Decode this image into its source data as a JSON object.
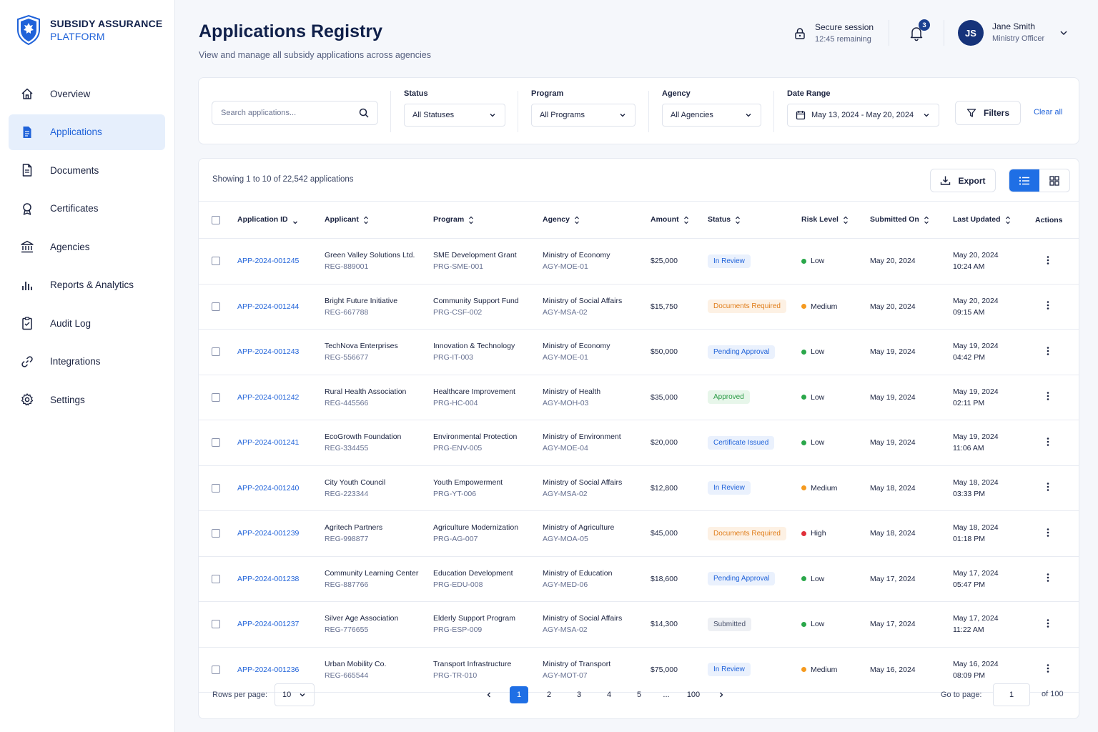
{
  "brand": {
    "line1": "SUBSIDY ASSURANCE",
    "line2": "PLATFORM"
  },
  "nav": [
    {
      "label": "Overview",
      "icon": "home-icon"
    },
    {
      "label": "Applications",
      "icon": "file-icon",
      "active": true
    },
    {
      "label": "Documents",
      "icon": "document-icon"
    },
    {
      "label": "Certificates",
      "icon": "certificate-icon"
    },
    {
      "label": "Agencies",
      "icon": "bank-icon"
    },
    {
      "label": "Reports & Analytics",
      "icon": "bar-chart-icon"
    },
    {
      "label": "Audit Log",
      "icon": "clipboard-icon"
    },
    {
      "label": "Integrations",
      "icon": "link-icon"
    },
    {
      "label": "Settings",
      "icon": "gear-icon"
    }
  ],
  "header": {
    "title": "Applications Registry",
    "subtitle": "View and manage all subsidy applications across agencies",
    "session_title": "Secure session",
    "session_time": "12:45 remaining",
    "notifications": "3",
    "user_initials": "JS",
    "user_name": "Jane Smith",
    "user_role": "Ministry Officer"
  },
  "filters": {
    "search_placeholder": "Search applications...",
    "status_label": "Status",
    "status_value": "All Statuses",
    "program_label": "Program",
    "program_value": "All Programs",
    "agency_label": "Agency",
    "agency_value": "All Agencies",
    "date_label": "Date Range",
    "date_value": "May 13, 2024 - May 20, 2024",
    "filters_button": "Filters",
    "clear_all": "Clear all"
  },
  "table": {
    "showing": "Showing 1 to 10 of 22,542 applications",
    "export": "Export",
    "columns": [
      "Application ID",
      "Applicant",
      "Program",
      "Agency",
      "Amount",
      "Status",
      "Risk Level",
      "Submitted On",
      "Last Updated",
      "Actions"
    ],
    "rows": [
      {
        "id": "APP-2024-001245",
        "applicant": "Green Valley Solutions Ltd.",
        "reg": "REG-889001",
        "program": "SME Development Grant",
        "prg": "PRG-SME-001",
        "agency": "Ministry of Economy",
        "agy": "AGY-MOE-01",
        "amount": "$25,000",
        "status": "In Review",
        "status_class": "b-review",
        "risk": "Low",
        "risk_class": "dot-low",
        "submitted": "May 20, 2024",
        "updated_date": "May 20, 2024",
        "updated_time": "10:24 AM"
      },
      {
        "id": "APP-2024-001244",
        "applicant": "Bright Future Initiative",
        "reg": "REG-667788",
        "program": "Community Support Fund",
        "prg": "PRG-CSF-002",
        "agency": "Ministry of Social Affairs",
        "agy": "AGY-MSA-02",
        "amount": "$15,750",
        "status": "Documents Required",
        "status_class": "b-docs",
        "risk": "Medium",
        "risk_class": "dot-medium",
        "submitted": "May 20, 2024",
        "updated_date": "May 20, 2024",
        "updated_time": "09:15 AM"
      },
      {
        "id": "APP-2024-001243",
        "applicant": "TechNova Enterprises",
        "reg": "REG-556677",
        "program": "Innovation & Technology",
        "prg": "PRG-IT-003",
        "agency": "Ministry of Economy",
        "agy": "AGY-MOE-01",
        "amount": "$50,000",
        "status": "Pending Approval",
        "status_class": "b-pending",
        "risk": "Low",
        "risk_class": "dot-low",
        "submitted": "May 19, 2024",
        "updated_date": "May 19, 2024",
        "updated_time": "04:42 PM"
      },
      {
        "id": "APP-2024-001242",
        "applicant": "Rural Health Association",
        "reg": "REG-445566",
        "program": "Healthcare Improvement",
        "prg": "PRG-HC-004",
        "agency": "Ministry of Health",
        "agy": "AGY-MOH-03",
        "amount": "$35,000",
        "status": "Approved",
        "status_class": "b-approved",
        "risk": "Low",
        "risk_class": "dot-low",
        "submitted": "May 19, 2024",
        "updated_date": "May 19, 2024",
        "updated_time": "02:11 PM"
      },
      {
        "id": "APP-2024-001241",
        "applicant": "EcoGrowth Foundation",
        "reg": "REG-334455",
        "program": "Environmental Protection",
        "prg": "PRG-ENV-005",
        "agency": "Ministry of Environment",
        "agy": "AGY-MOE-04",
        "amount": "$20,000",
        "status": "Certificate Issued",
        "status_class": "b-cert",
        "risk": "Low",
        "risk_class": "dot-low",
        "submitted": "May 19, 2024",
        "updated_date": "May 19, 2024",
        "updated_time": "11:06 AM"
      },
      {
        "id": "APP-2024-001240",
        "applicant": "City Youth Council",
        "reg": "REG-223344",
        "program": "Youth Empowerment",
        "prg": "PRG-YT-006",
        "agency": "Ministry of Social Affairs",
        "agy": "AGY-MSA-02",
        "amount": "$12,800",
        "status": "In Review",
        "status_class": "b-review",
        "risk": "Medium",
        "risk_class": "dot-medium",
        "submitted": "May 18, 2024",
        "updated_date": "May 18, 2024",
        "updated_time": "03:33 PM"
      },
      {
        "id": "APP-2024-001239",
        "applicant": "Agritech Partners",
        "reg": "REG-998877",
        "program": "Agriculture Modernization",
        "prg": "PRG-AG-007",
        "agency": "Ministry of Agriculture",
        "agy": "AGY-MOA-05",
        "amount": "$45,000",
        "status": "Documents Required",
        "status_class": "b-docs",
        "risk": "High",
        "risk_class": "dot-high",
        "submitted": "May 18, 2024",
        "updated_date": "May 18, 2024",
        "updated_time": "01:18 PM"
      },
      {
        "id": "APP-2024-001238",
        "applicant": "Community Learning Center",
        "reg": "REG-887766",
        "program": "Education Development",
        "prg": "PRG-EDU-008",
        "agency": "Ministry of Education",
        "agy": "AGY-MED-06",
        "amount": "$18,600",
        "status": "Pending Approval",
        "status_class": "b-pending",
        "risk": "Low",
        "risk_class": "dot-low",
        "submitted": "May 17, 2024",
        "updated_date": "May 17, 2024",
        "updated_time": "05:47 PM"
      },
      {
        "id": "APP-2024-001237",
        "applicant": "Silver Age Association",
        "reg": "REG-776655",
        "program": "Elderly Support Program",
        "prg": "PRG-ESP-009",
        "agency": "Ministry of Social Affairs",
        "agy": "AGY-MSA-02",
        "amount": "$14,300",
        "status": "Submitted",
        "status_class": "b-submitted",
        "risk": "Low",
        "risk_class": "dot-low",
        "submitted": "May 17, 2024",
        "updated_date": "May 17, 2024",
        "updated_time": "11:22 AM"
      },
      {
        "id": "APP-2024-001236",
        "applicant": "Urban Mobility Co.",
        "reg": "REG-665544",
        "program": "Transport Infrastructure",
        "prg": "PRG-TR-010",
        "agency": "Ministry of Transport",
        "agy": "AGY-MOT-07",
        "amount": "$75,000",
        "status": "In Review",
        "status_class": "b-review",
        "risk": "Medium",
        "risk_class": "dot-medium",
        "submitted": "May 16, 2024",
        "updated_date": "May 16, 2024",
        "updated_time": "08:09 PM"
      }
    ]
  },
  "pagination": {
    "rows_label": "Rows per page:",
    "rows_value": "10",
    "pages": [
      "1",
      "2",
      "3",
      "4",
      "5",
      "...",
      "100"
    ],
    "current": "1",
    "goto_label": "Go to page:",
    "goto_value": "1",
    "of_total": "of 100"
  },
  "colors": {
    "accent": "#1f6fe5",
    "brand_navy": "#10204a",
    "low": "#2aa74a",
    "medium": "#f59a1f",
    "high": "#e0303a"
  }
}
